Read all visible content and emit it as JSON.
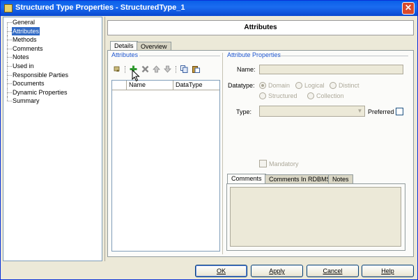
{
  "window": {
    "title": "Structured Type Properties - StructuredType_1",
    "close_glyph": "✕"
  },
  "nav": {
    "items": [
      {
        "label": "General",
        "selected": false
      },
      {
        "label": "Attributes",
        "selected": true
      },
      {
        "label": "Methods",
        "selected": false
      },
      {
        "label": "Comments",
        "selected": false
      },
      {
        "label": "Notes",
        "selected": false
      },
      {
        "label": "Used in",
        "selected": false
      },
      {
        "label": "Responsible Parties",
        "selected": false
      },
      {
        "label": "Documents",
        "selected": false
      },
      {
        "label": "Dynamic Properties",
        "selected": false
      },
      {
        "label": "Summary",
        "selected": false
      }
    ]
  },
  "header": {
    "title": "Attributes"
  },
  "tabs": {
    "details": "Details",
    "overview": "Overview",
    "selected": "Details"
  },
  "attributes_group": {
    "title": "Attributes",
    "toolbar": [
      "properties-icon",
      "add-icon",
      "delete-icon",
      "move-up-icon",
      "move-down-icon",
      "copy-icon",
      "paste-icon"
    ],
    "columns": [
      "Name",
      "DataType"
    ],
    "rows": []
  },
  "attribute_properties": {
    "title": "Attribute Properties",
    "name_label": "Name:",
    "name_value": "",
    "datatype_label": "Datatype:",
    "datatype_options": [
      "Domain",
      "Logical",
      "Distinct",
      "Structured",
      "Collection"
    ],
    "datatype_selected": "Domain",
    "type_label": "Type:",
    "type_value": "",
    "preferred_label": "Preferred",
    "preferred_checked": false,
    "mandatory_label": "Mandatory",
    "mandatory_checked": false
  },
  "comment_tabs": {
    "comments": "Comments",
    "comments_rdbms": "Comments In RDBMS",
    "notes": "Notes",
    "selected": "Comments"
  },
  "buttons": {
    "ok": "OK",
    "apply": "Apply",
    "cancel": "Cancel",
    "help": "Help"
  },
  "colors": {
    "titlebar": "#0a5fe8",
    "selection": "#316ac5",
    "group_title": "#1d55d0",
    "add_icon": "#2f9a2f"
  }
}
